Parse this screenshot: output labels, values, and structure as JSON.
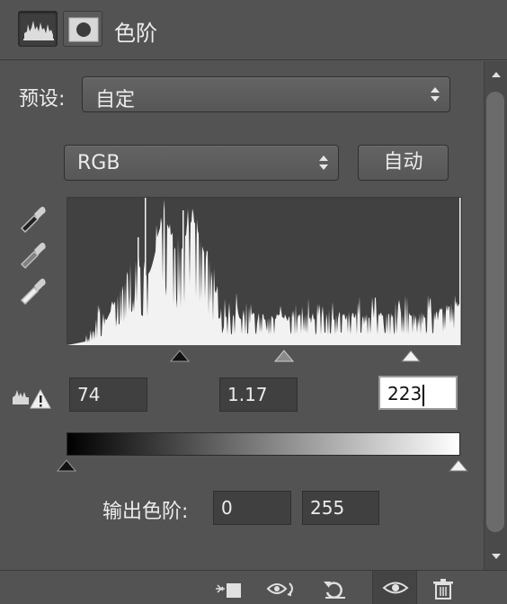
{
  "panel": {
    "title": "色阶",
    "tabs": [
      {
        "name": "levels-adjustment-icon",
        "active": true
      },
      {
        "name": "mask-icon",
        "active": false
      }
    ]
  },
  "preset": {
    "label": "预设:",
    "value": "自定"
  },
  "channel": {
    "value": "RGB",
    "auto_label": "自动"
  },
  "input_levels": {
    "shadow": "74",
    "midtone": "1.17",
    "highlight": "223"
  },
  "output_levels": {
    "label": "输出色阶:",
    "low": "0",
    "high": "255"
  },
  "footer_icons": [
    "clip-to-layer-icon",
    "view-previous-icon",
    "reset-icon",
    "visibility-eye-icon",
    "trash-icon"
  ],
  "colors": {
    "panel_bg": "#535353",
    "histogram_bg": "#414141",
    "field_bg": "#404040"
  }
}
